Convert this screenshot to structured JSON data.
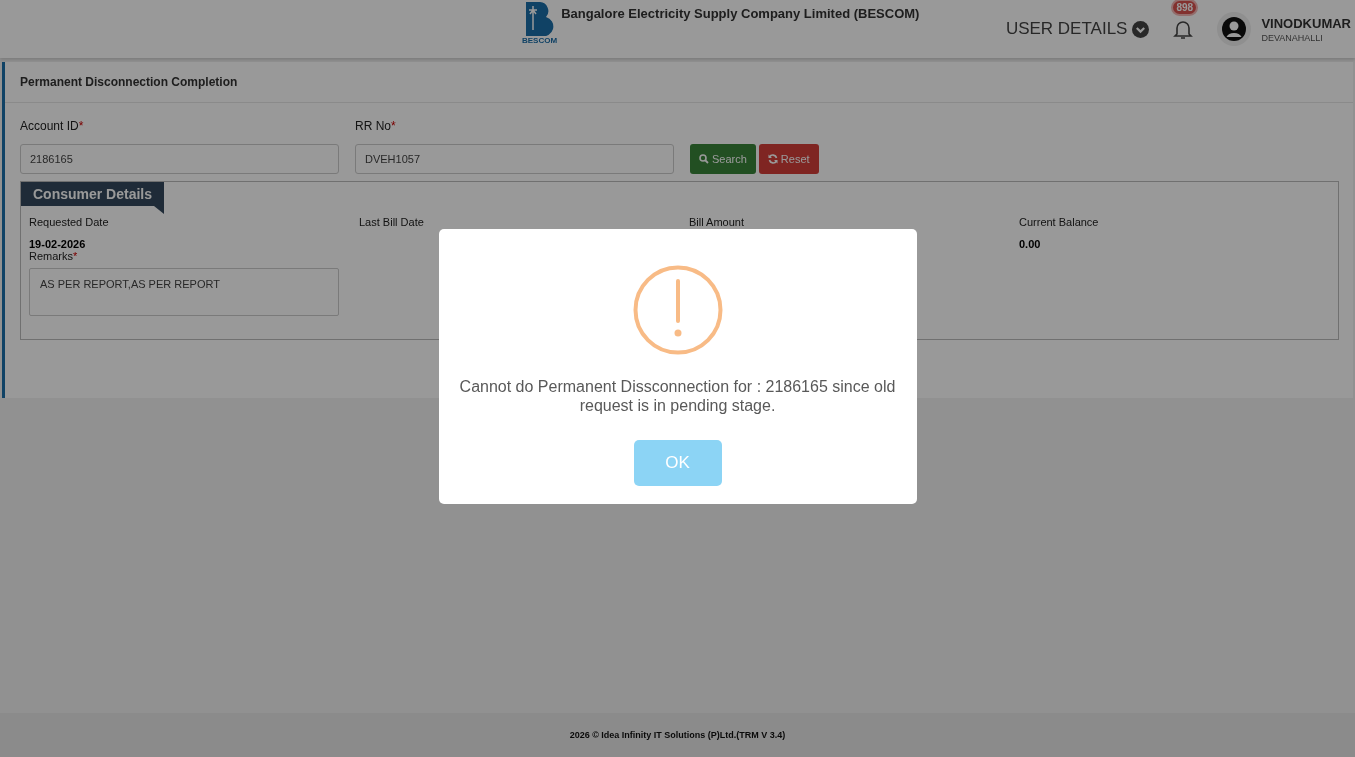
{
  "header": {
    "company": "Bangalore Electricity Supply Company Limited (BESCOM)",
    "logo_caption": "BESCOM",
    "user_details": "USER DETAILS",
    "notification_count": "898",
    "user_name": "VINODKUMAR",
    "user_location": "DEVANAHALLI"
  },
  "card": {
    "title": "Permanent Disconnection Completion",
    "fields": [
      {
        "label": "Account ID",
        "required_mark": "*",
        "value": "2186165"
      },
      {
        "label": "RR No",
        "required_mark": "*",
        "value": "DVEH1057"
      }
    ],
    "buttons": [
      {
        "kind": "search",
        "label": "Search"
      },
      {
        "kind": "reset",
        "label": "Reset"
      }
    ],
    "section": {
      "title": "Consumer Details",
      "details": [
        {
          "label": "Requested Date",
          "value": "19-02-2026"
        },
        {
          "label": "Last Bill Date"
        },
        {
          "label": "Bill Amount"
        },
        {
          "label": "Current Balance",
          "value": "0.00"
        }
      ],
      "remarks": {
        "label": "Remarks",
        "required_mark": "*",
        "value": "AS PER REPORT,AS PER REPORT"
      }
    }
  },
  "dialog": {
    "message": "Cannot do Permanent Dissconnection for : 2186165 since old request is in pending stage.",
    "button": "OK"
  },
  "footer": "2026 © Idea Infinity IT Solutions (P)Ltd.(TRM V 3.4)"
}
